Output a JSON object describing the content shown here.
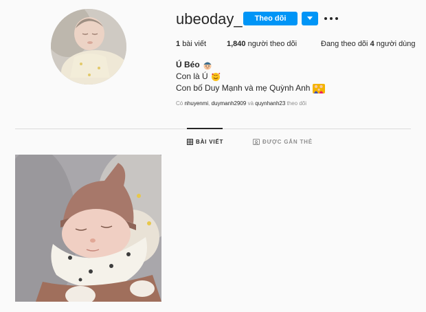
{
  "profile": {
    "username": "ubeoday_",
    "follow_label": "Theo dõi"
  },
  "stats": {
    "posts_count": "1",
    "posts_label": "bài viết",
    "followers_count": "1,840",
    "followers_label": "người theo dõi",
    "following_prefix": "Đang theo dõi",
    "following_count": "4",
    "following_label": "người dùng"
  },
  "bio": {
    "name": "Ú Béo",
    "line1": "Con là Ú",
    "line2": "Con bố Duy Mạnh và mẹ Quỳnh Anh"
  },
  "followed_by": {
    "prefix": "Có",
    "user1": "nhuyenmi",
    "user2": "duymanh2909",
    "conj": "và",
    "user3": "quynhanh23",
    "suffix": "theo dõi"
  },
  "tabs": {
    "posts": "BÀI VIẾT",
    "tagged": "ĐƯỢC GẮN THẺ"
  },
  "icons": {
    "dropdown": "chevron-down-icon",
    "more": "more-horizontal-icon",
    "grid": "grid-icon",
    "tagged": "tagged-icon"
  },
  "colors": {
    "accent": "#0095f6",
    "text": "#262626",
    "muted": "#8e8e8e"
  }
}
